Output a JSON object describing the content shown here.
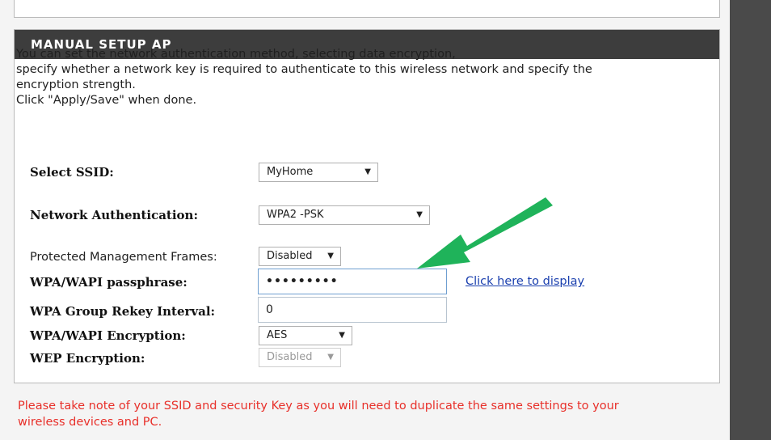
{
  "panel": {
    "title": "MANUAL SETUP AP",
    "intro_lines": [
      "You can set the network authentication method, selecting data encryption,",
      "specify whether a network key is required to authenticate to this wireless network and specify the",
      "encryption strength.",
      "Click \"Apply/Save\" when done."
    ]
  },
  "form": {
    "ssid": {
      "label": "Select SSID:",
      "value": "MyHome"
    },
    "auth": {
      "label": "Network Authentication:",
      "value": "WPA2 -PSK"
    },
    "pmf": {
      "label": "Protected Management Frames:",
      "value": "Disabled"
    },
    "passphrase": {
      "label": "WPA/WAPI passphrase:",
      "value": "•••••••••",
      "display_link": "Click here to display"
    },
    "rekey": {
      "label": "WPA Group Rekey Interval:",
      "value": "0"
    },
    "encryption": {
      "label": "WPA/WAPI Encryption:",
      "value": "AES"
    },
    "wep": {
      "label": "WEP Encryption:",
      "value": "Disabled"
    }
  },
  "note": {
    "lines": [
      "Please take note of your SSID and security Key as you will need to duplicate the same settings to your",
      "wireless devices and PC."
    ]
  },
  "colors": {
    "header_bg": "#3d3d3d",
    "link": "#1a3fae",
    "note_text": "#e8302a",
    "arrow": "#1fb35a",
    "right_panel": "#4a4a4a"
  },
  "icons": {
    "dropdown": "chevron-down-icon",
    "annotation": "green-arrow-icon"
  }
}
